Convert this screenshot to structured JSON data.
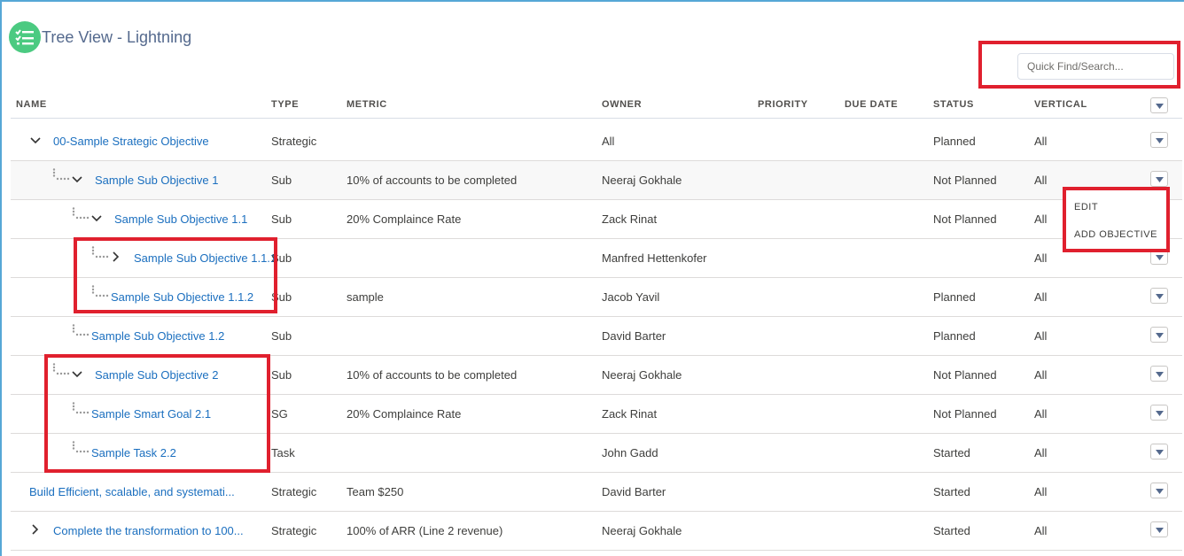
{
  "app": {
    "title": "Tree View - Lightning",
    "icon": "list-check-icon",
    "accent_color": "#4bca81"
  },
  "search": {
    "placeholder": "Quick Find/Search..."
  },
  "columns": [
    "NAME",
    "TYPE",
    "METRIC",
    "OWNER",
    "PRIORITY",
    "DUE DATE",
    "STATUS",
    "VERTICAL"
  ],
  "rows": [
    {
      "name": "00-Sample Strategic Objective",
      "type": "Strategic",
      "metric": "",
      "owner": "All",
      "priority": "",
      "due_date": "",
      "status": "Planned",
      "vertical": "All",
      "toggle": "expanded",
      "level": 0
    },
    {
      "name": "Sample Sub Objective 1",
      "type": "Sub",
      "metric": "10% of accounts to be completed",
      "owner": "Neeraj Gokhale",
      "priority": "",
      "due_date": "",
      "status": "Not Planned",
      "vertical": "All",
      "toggle": "expanded",
      "level": 1
    },
    {
      "name": "Sample Sub Objective 1.1",
      "type": "Sub",
      "metric": "20% Complaince Rate",
      "owner": "Zack Rinat",
      "priority": "",
      "due_date": "",
      "status": "Not Planned",
      "vertical": "All",
      "toggle": "expanded",
      "level": 2
    },
    {
      "name": "Sample Sub Objective 1.1.1",
      "type": "Sub",
      "metric": "",
      "owner": "Manfred Hettenkofer",
      "priority": "",
      "due_date": "",
      "status": "",
      "vertical": "All",
      "toggle": "collapsed",
      "level": 3
    },
    {
      "name": "Sample Sub Objective 1.1.2",
      "type": "Sub",
      "metric": "sample",
      "owner": "Jacob Yavil",
      "priority": "",
      "due_date": "",
      "status": "Planned",
      "vertical": "All",
      "toggle": "none",
      "level": 3
    },
    {
      "name": "Sample Sub Objective 1.2",
      "type": "Sub",
      "metric": "",
      "owner": "David Barter",
      "priority": "",
      "due_date": "",
      "status": "Planned",
      "vertical": "All",
      "toggle": "none",
      "level": 2
    },
    {
      "name": "Sample Sub Objective 2",
      "type": "Sub",
      "metric": "10% of accounts to be completed",
      "owner": "Neeraj Gokhale",
      "priority": "",
      "due_date": "",
      "status": "Not Planned",
      "vertical": "All",
      "toggle": "expanded",
      "level": 1
    },
    {
      "name": "Sample Smart Goal 2.1",
      "type": "SG",
      "metric": "20% Complaince Rate",
      "owner": "Zack Rinat",
      "priority": "",
      "due_date": "",
      "status": "Not Planned",
      "vertical": "All",
      "toggle": "none",
      "level": 2
    },
    {
      "name": "Sample Task 2.2",
      "type": "Task",
      "metric": "",
      "owner": "John Gadd",
      "priority": "",
      "due_date": "",
      "status": "Started",
      "vertical": "All",
      "toggle": "none",
      "level": 2
    },
    {
      "name": "Build Efficient, scalable, and systemati...",
      "type": "Strategic",
      "metric": "Team $250",
      "owner": "David Barter",
      "priority": "",
      "due_date": "",
      "status": "Started",
      "vertical": "All",
      "toggle": "none",
      "level": 0
    },
    {
      "name": "Complete the transformation to 100...",
      "type": "Strategic",
      "metric": "100% of ARR (Line 2 revenue)",
      "owner": "Neeraj Gokhale",
      "priority": "",
      "due_date": "",
      "status": "Started",
      "vertical": "All",
      "toggle": "collapsed",
      "level": 0
    }
  ],
  "row_menu": {
    "items": [
      "EDIT",
      "ADD OBJECTIVE"
    ]
  },
  "highlight_color": "#e0202e"
}
